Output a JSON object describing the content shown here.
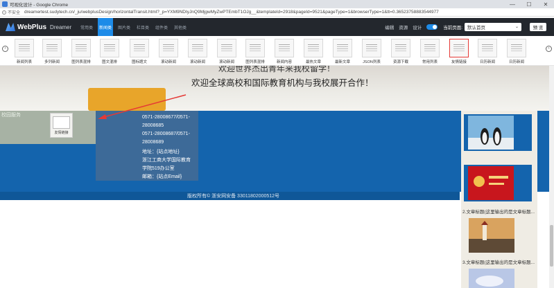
{
  "browser": {
    "title": "可视化设计 - Google Chrome",
    "security": "不安全",
    "url": "dreamertest.sudytech.cn/_ju/webplusDesign/horizontalTransit.html?_p=YXM9NDIyJnQ9MjgwMyZwPTEmbT1OJg__&templateId=2918&pageId=9521&pageType=1&browserType=1&tt=0.36523758883544977",
    "controls": [
      "—",
      "☐",
      "✕"
    ]
  },
  "header": {
    "brand": "WebPlus",
    "brand_sub": "Dreamer",
    "tabs": [
      "常用类",
      "新闻类",
      "图片类",
      "栏目类",
      "组件类",
      "其他类"
    ],
    "active_tab": 1,
    "links": [
      "编辑",
      "资源",
      "设计"
    ],
    "current_page_label": "当前页面:",
    "current_page_value": "默认首页",
    "publish_label": "预 览"
  },
  "toolbar": {
    "items": [
      {
        "label": "新闻列表"
      },
      {
        "label": "多列新闻"
      },
      {
        "label": "图列表混排"
      },
      {
        "label": "图文混排"
      },
      {
        "label": "图标题文"
      },
      {
        "label": "滚动新闻"
      },
      {
        "label": "滚动新闻"
      },
      {
        "label": "滚动新闻"
      },
      {
        "label": "图列表混排"
      },
      {
        "label": "新闻内容"
      },
      {
        "label": "最热文章"
      },
      {
        "label": "最新文章"
      },
      {
        "label": "JSON列表"
      },
      {
        "label": "资源下载"
      },
      {
        "label": "常用列表"
      },
      {
        "label": "友情链接"
      },
      {
        "label": "日历新闻"
      },
      {
        "label": "日历新闻"
      }
    ],
    "selected_index": 15
  },
  "canvas": {
    "banner_line1": "欢迎世界杰出青年来我校留学！",
    "banner_line2": "欢迎全球高校和国际教育机构与我校展开合作！",
    "section_label": "校园服务",
    "widget_label": "友情链接",
    "contact_lines": [
      "0571-28008677/0571-",
      "28008685",
      "0571-28008687/0571-",
      "28008689",
      "地址：{站点地址}",
      "浙江工商大学国际教育",
      "学院519办公室",
      "邮箱：{站点Email}"
    ],
    "footer_copy": "版权所有© 浙安网安备 33011802000512号",
    "news_captions": [
      "2.文章标题(这里输出的是文章标题...",
      "3.文章标题(这里输出的是文章标题..."
    ]
  },
  "colors": {
    "header_bg": "#23272d",
    "accent": "#1d8be8",
    "blue_area": "#1464ad",
    "orange": "#e8a52a",
    "arrow_red": "#e53935"
  }
}
